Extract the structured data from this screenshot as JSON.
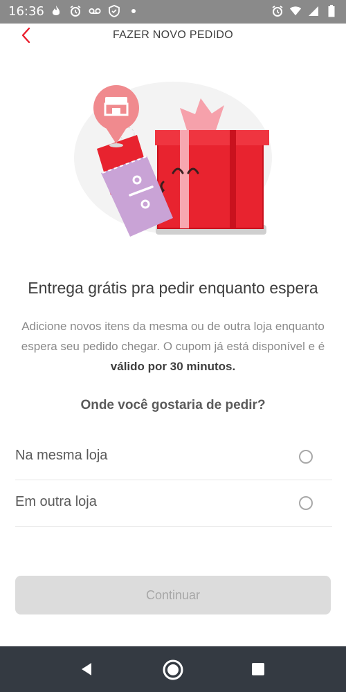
{
  "status_bar": {
    "time": "16:36",
    "left_icons": [
      "fire-icon",
      "alarm-icon",
      "voicemail-icon",
      "shield-icon",
      "dot-icon"
    ],
    "right_icons": [
      "alarm-icon",
      "wifi-icon",
      "signal-icon",
      "battery-icon"
    ]
  },
  "header": {
    "title": "FAZER NOVO PEDIDO",
    "back_icon": "chevron-left-icon"
  },
  "content": {
    "headline": "Entrega grátis pra pedir enquanto espera",
    "description_part1": "Adicione novos itens da mesma ou de outra loja enquanto espera seu pedido chegar. O cupom já está disponível e é ",
    "description_bold": "válido por 30 minutos.",
    "question": "Onde você gostaria de pedir?"
  },
  "options": [
    {
      "label": "Na mesma loja",
      "selected": false
    },
    {
      "label": "Em outra loja",
      "selected": false
    }
  ],
  "continue_button": {
    "label": "Continuar",
    "enabled": false
  },
  "nav_bar": {
    "icons": [
      "back-triangle-icon",
      "home-circle-icon",
      "recents-square-icon"
    ]
  },
  "colors": {
    "brand_red": "#ea1d2c",
    "ticket_purple": "#c9a3d6",
    "pin_pink": "#f08a8e",
    "button_disabled_bg": "#dcdcdc",
    "nav_bg": "#343a42"
  }
}
